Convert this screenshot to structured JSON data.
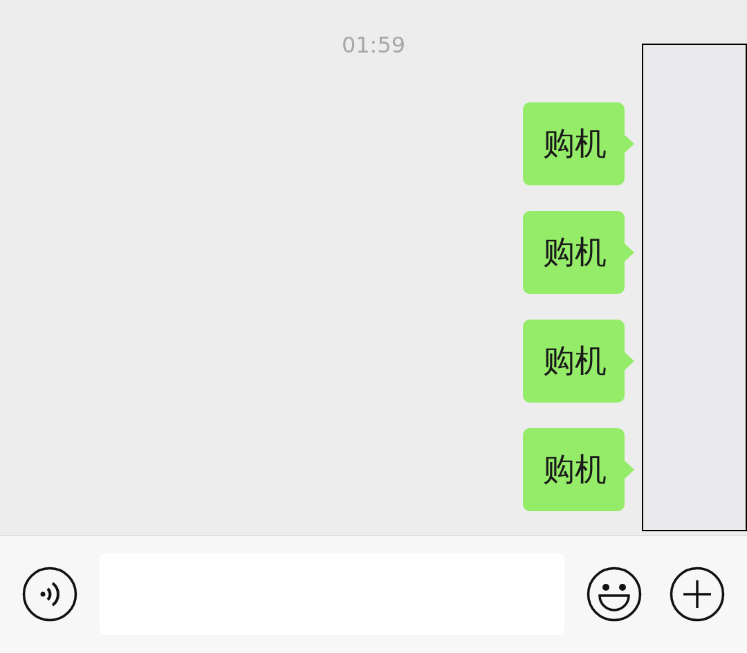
{
  "timestamp": "01:59",
  "messages": [
    {
      "text": "购机",
      "kind": "outgoing"
    },
    {
      "text": "购机",
      "kind": "outgoing"
    },
    {
      "text": "购机",
      "kind": "outgoing"
    },
    {
      "text": "购机",
      "kind": "outgoing"
    }
  ]
}
